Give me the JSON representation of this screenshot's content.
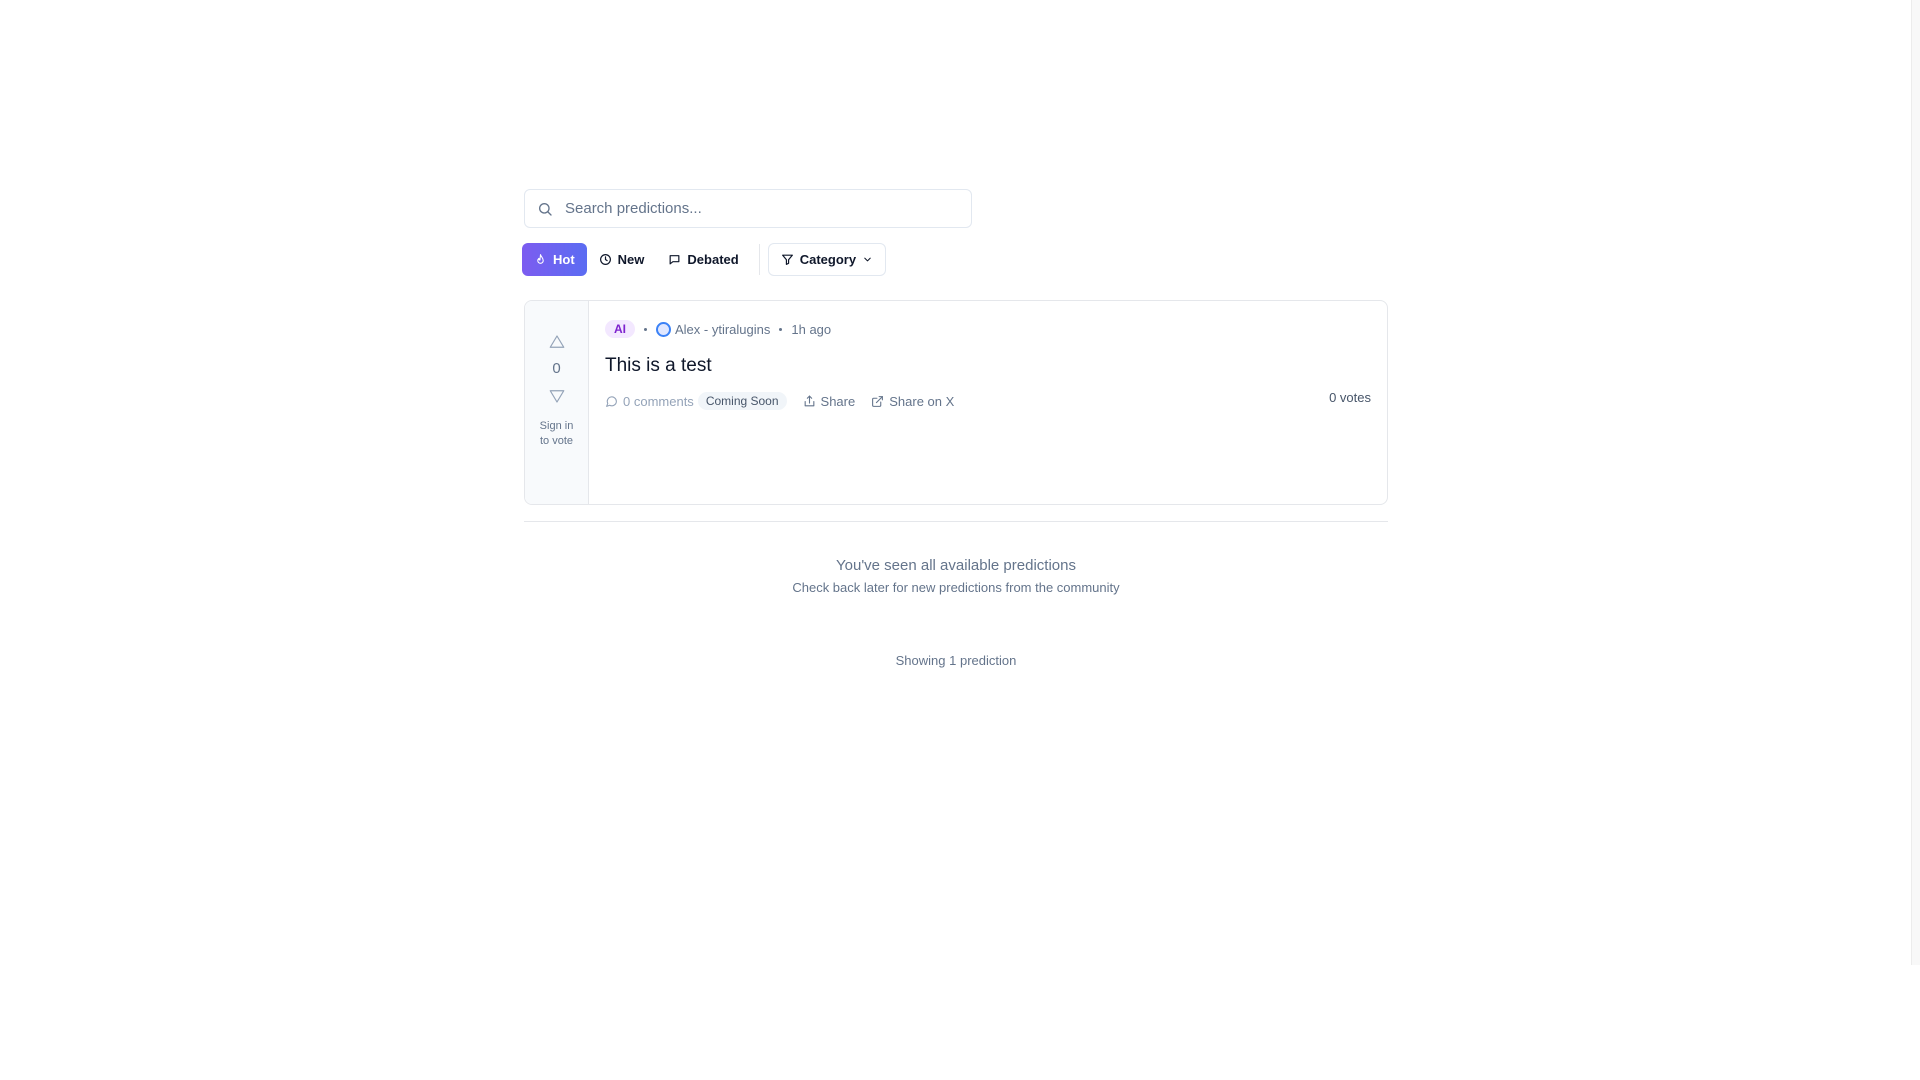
{
  "search": {
    "placeholder": "Search predictions..."
  },
  "filters": {
    "tabs": [
      {
        "label": "Hot",
        "icon": "flame-icon"
      },
      {
        "label": "New",
        "icon": "clock-icon"
      },
      {
        "label": "Debated",
        "icon": "message-icon"
      }
    ],
    "category_label": "Category"
  },
  "posts": [
    {
      "category_badge": "AI",
      "author": "Alex - ytiralugins",
      "time_ago": "1h ago",
      "title": "This is a test",
      "vote_count": "0",
      "vote_hint": "Sign in to vote",
      "comments_label": "0 comments",
      "coming_soon_label": "Coming Soon",
      "share_label": "Share",
      "share_x_label": "Share on X",
      "votes_total": "0 votes"
    }
  ],
  "feed_end": {
    "title": "You've seen all available predictions",
    "subtitle": "Check back later for new predictions from the community"
  },
  "showing_label": "Showing 1 prediction",
  "colors": {
    "accent_start": "#7c5cf0",
    "accent_end": "#5b6cf2",
    "ai_badge_bg": "#f3e8ff",
    "ai_badge_text": "#7e22ce"
  }
}
